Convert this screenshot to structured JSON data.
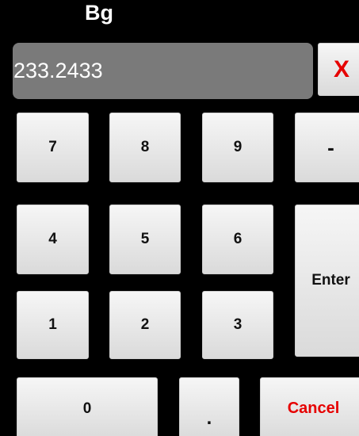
{
  "title": "Bg",
  "display": {
    "value": "233.2433"
  },
  "keys": {
    "clear": "X",
    "k7": "7",
    "k8": "8",
    "k9": "9",
    "minus": "-",
    "k4": "4",
    "k5": "5",
    "k6": "6",
    "enter": "Enter",
    "k1": "1",
    "k2": "2",
    "k3": "3",
    "k0": "0",
    "dot": ".",
    "cancel": "Cancel"
  },
  "colors": {
    "background": "#000000",
    "display": "#7a7a7a",
    "key": "#e6e6e6",
    "danger": "#e60000"
  }
}
